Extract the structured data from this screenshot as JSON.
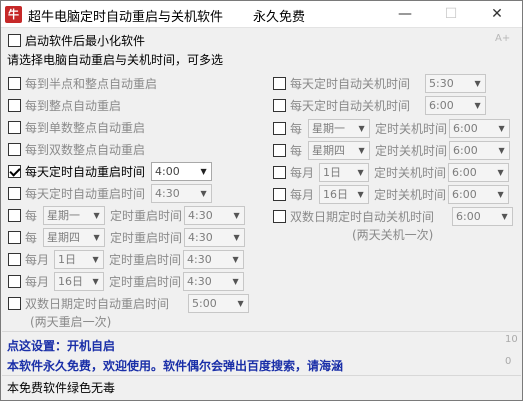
{
  "window": {
    "title": "超牛电脑定时自动重启与关机软件",
    "subtitle": "永久免费",
    "minimize_glyph": "—",
    "maximize_glyph": "☐",
    "close_glyph": "✕",
    "icon": "app-logo-icon"
  },
  "font_size_button": "A+",
  "minimize_on_start": {
    "label": "启动软件后最小化软件",
    "checked": false
  },
  "instruction": "请选择电脑自动重启与关机时间，可多选",
  "restart_options": [
    {
      "label": "每到半点和整点自动重启",
      "checked": false
    },
    {
      "label": "每到整点自动重启",
      "checked": false
    },
    {
      "label": "每到单数整点自动重启",
      "checked": false
    },
    {
      "label": "每到双数整点自动重启",
      "checked": false
    },
    {
      "label": "每天定时自动重启时间",
      "checked": true,
      "time": "4:00"
    },
    {
      "label": "每天定时自动重启时间",
      "checked": false,
      "time": "4:30"
    },
    {
      "prefix": "每",
      "day": "星期一",
      "label": "定时重启时间",
      "checked": false,
      "time": "4:30"
    },
    {
      "prefix": "每",
      "day": "星期四",
      "label": "定时重启时间",
      "checked": false,
      "time": "4:30"
    },
    {
      "prefix": "每月",
      "day": "1日",
      "label": "定时重启时间",
      "checked": false,
      "time": "4:30"
    },
    {
      "prefix": "每月",
      "day": "16日",
      "label": "定时重启时间",
      "checked": false,
      "time": "4:30"
    },
    {
      "label": "双数日期定时自动重启时间",
      "checked": false,
      "time": "5:00",
      "note": "(两天重启一次)"
    }
  ],
  "shutdown_options": [
    {
      "label": "每天定时自动关机时间",
      "checked": false,
      "time": "5:30"
    },
    {
      "label": "每天定时自动关机时间",
      "checked": false,
      "time": "6:00"
    },
    {
      "prefix": "每",
      "day": "星期一",
      "label": "定时关机时间",
      "checked": false,
      "time": "6:00"
    },
    {
      "prefix": "每",
      "day": "星期四",
      "label": "定时关机时间",
      "checked": false,
      "time": "6:00"
    },
    {
      "prefix": "每月",
      "day": "1日",
      "label": "定时关机时间",
      "checked": false,
      "time": "6:00"
    },
    {
      "prefix": "每月",
      "day": "16日",
      "label": "定时关机时间",
      "checked": false,
      "time": "6:00"
    },
    {
      "label": "双数日期定时自动关机时间",
      "checked": false,
      "time": "6:00",
      "note": "(两天关机一次)"
    }
  ],
  "footer": {
    "boot_link": "点这设置：开机自启",
    "notice": "本软件永久免费，欢迎使用。软件偶尔会弹出百度搜索，请海涵",
    "status": "本免费软件绿色无毒",
    "side_number_1": "10",
    "side_number_2": "0"
  },
  "colors": {
    "accent_blue": "#1a2fa8",
    "disabled_text": "#8a8a8a"
  }
}
